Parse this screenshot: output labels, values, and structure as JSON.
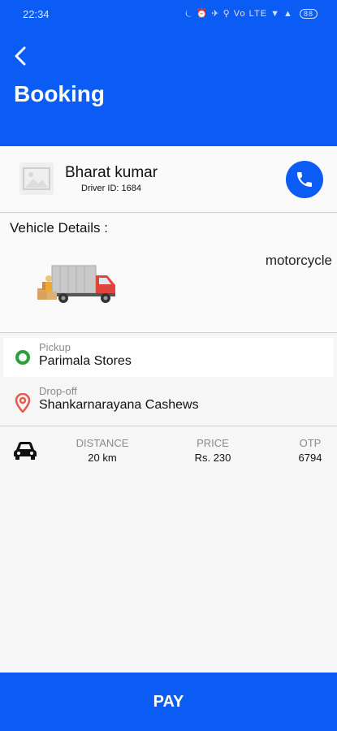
{
  "status_bar": {
    "time": "22:34",
    "icons_text": "⏾ ⏰ ✈ ⚲ Vo LTE ▼ ▲",
    "battery": "88"
  },
  "header": {
    "title": "Booking",
    "back_icon": "chevron-left-icon"
  },
  "driver": {
    "name": "Bharat kumar",
    "driver_id": "Driver ID: 1684",
    "avatar_icon": "image-placeholder-icon",
    "call_icon": "phone-icon"
  },
  "vehicle": {
    "heading": "Vehicle Details :",
    "type": "motorcycle",
    "image_icon": "delivery-truck-icon"
  },
  "pickup": {
    "label": "Pickup",
    "value": "Parimala Stores",
    "icon": "pickup-circle-icon",
    "icon_color": "#2e9e3e"
  },
  "dropoff": {
    "label": "Drop-off",
    "value": "Shankarnarayana Cashews",
    "icon": "location-pin-icon",
    "icon_color": "#e85a50"
  },
  "stats": {
    "distance_label": "DISTANCE",
    "distance_value": "20 km",
    "price_label": "PRICE",
    "price_value": "Rs. 230",
    "otp_label": "OTP",
    "otp_value": "6794",
    "car_icon": "car-icon"
  },
  "pay_button": {
    "label": "PAY"
  },
  "colors": {
    "primary": "#0a5cf5",
    "background": "#f6f6f6"
  }
}
